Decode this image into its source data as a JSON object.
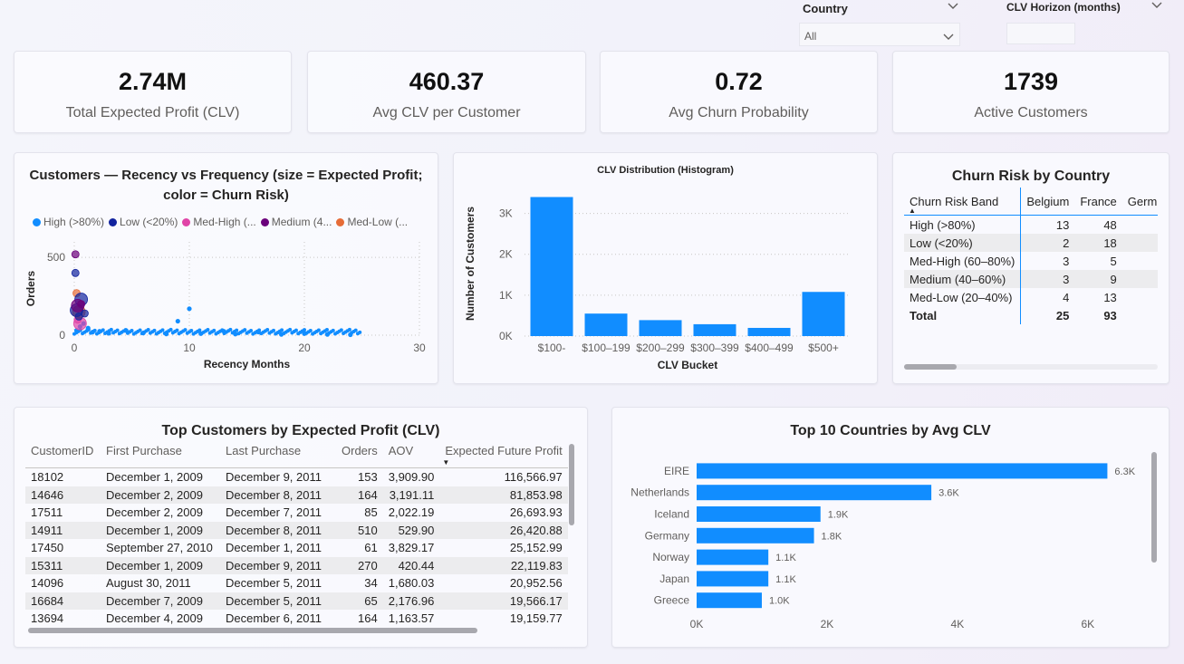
{
  "filters": {
    "country": {
      "label": "Country",
      "value": "All"
    },
    "horizon": {
      "label": "CLV Horizon (months)",
      "value": ""
    }
  },
  "kpis": [
    {
      "value": "2.74M",
      "label": "Total Expected Profit (CLV)"
    },
    {
      "value": "460.37",
      "label": "Avg CLV per Customer"
    },
    {
      "value": "0.72",
      "label": "Avg Churn Probability"
    },
    {
      "value": "1739",
      "label": "Active Customers"
    }
  ],
  "scatter": {
    "title_line1": "Customers — Recency vs Frequency (size = Expected Profit;",
    "title_line2": "color = Churn Risk)",
    "legend": [
      {
        "label": "High (>80%)",
        "color": "#118dff"
      },
      {
        "label": "Low (<20%)",
        "color": "#12239e"
      },
      {
        "label": "Med-High (...",
        "color": "#e044a7"
      },
      {
        "label": "Medium (4...",
        "color": "#6b007b"
      },
      {
        "label": "Med-Low (...",
        "color": "#e66c37"
      }
    ],
    "chart_data": {
      "type": "scatter",
      "xlabel": "Recency Months",
      "ylabel": "Orders",
      "xlim": [
        0,
        30
      ],
      "ylim": [
        0,
        600
      ],
      "x_ticks": [
        "0",
        "10",
        "20",
        "30"
      ],
      "y_ticks": [
        "0",
        "500"
      ],
      "series": [
        {
          "name": "High (>80%)",
          "points": [
            [
              0.2,
              30
            ],
            [
              0.5,
              55
            ],
            [
              0.8,
              75
            ],
            [
              1.2,
              45
            ],
            [
              1.6,
              20
            ],
            [
              2.2,
              25
            ],
            [
              3,
              12
            ],
            [
              4.5,
              30
            ],
            [
              6,
              14
            ],
            [
              8,
              8
            ],
            [
              9,
              90
            ],
            [
              10,
              170
            ],
            [
              11,
              10
            ],
            [
              13,
              25
            ],
            [
              14,
              7
            ],
            [
              16,
              20
            ],
            [
              18,
              5
            ],
            [
              20,
              10
            ],
            [
              22,
              5
            ],
            [
              24,
              3
            ]
          ]
        },
        {
          "name": "Low (<20%)",
          "points": [
            [
              0.1,
              400
            ],
            [
              0.2,
              160
            ],
            [
              0.4,
              120
            ],
            [
              0.6,
              230
            ],
            [
              0.9,
              140
            ]
          ]
        },
        {
          "name": "Med-High (60–80%)",
          "points": [
            [
              0.3,
              100
            ],
            [
              0.5,
              75
            ]
          ]
        },
        {
          "name": "Medium (40–60%)",
          "points": [
            [
              0.1,
              520
            ],
            [
              0.3,
              190
            ],
            [
              0.6,
              200
            ]
          ]
        },
        {
          "name": "Med-Low (20–40%)",
          "points": [
            [
              0.2,
              270
            ],
            [
              0.4,
              150
            ]
          ]
        }
      ]
    }
  },
  "histogram": {
    "title": "CLV Distribution (Histogram)",
    "chart_data": {
      "type": "bar",
      "categories": [
        "$100-",
        "$100–199",
        "$200–299",
        "$300–399",
        "$400–499",
        "$500+"
      ],
      "values": [
        3400,
        550,
        390,
        290,
        200,
        1080
      ],
      "xlabel": "CLV Bucket",
      "ylabel": "Number of Customers",
      "ylim": [
        0,
        3500
      ],
      "y_ticks": [
        "0K",
        "1K",
        "2K",
        "3K"
      ],
      "color": "#118dff"
    }
  },
  "churn_matrix": {
    "title": "Churn Risk by Country",
    "columns": [
      "Churn Risk Band",
      "Belgium",
      "France",
      "Germ"
    ],
    "rows": [
      [
        "High (>80%)",
        "13",
        "48"
      ],
      [
        "Low (<20%)",
        "2",
        "18"
      ],
      [
        "Med-High (60–80%)",
        "3",
        "5"
      ],
      [
        "Medium (40–60%)",
        "3",
        "9"
      ],
      [
        "Med-Low (20–40%)",
        "4",
        "13"
      ]
    ],
    "total": [
      "Total",
      "25",
      "93"
    ],
    "sort_icon": "▲"
  },
  "customers_table": {
    "title": "Top Customers by Expected Profit (CLV)",
    "columns": [
      "CustomerID",
      "First Purchase",
      "Last Purchase",
      "Orders",
      "AOV",
      "Expected Future Profit"
    ],
    "sort_icon": "▼",
    "rows": [
      [
        "18102",
        "December 1, 2009",
        "December 9, 2011",
        "153",
        "3,909.90",
        "116,566.97"
      ],
      [
        "14646",
        "December 2, 2009",
        "December 8, 2011",
        "164",
        "3,191.11",
        "81,853.98"
      ],
      [
        "17511",
        "December 2, 2009",
        "December 7, 2011",
        "85",
        "2,022.19",
        "26,693.93"
      ],
      [
        "14911",
        "December 1, 2009",
        "December 8, 2011",
        "510",
        "529.90",
        "26,420.88"
      ],
      [
        "17450",
        "September 27, 2010",
        "December 1, 2011",
        "61",
        "3,829.17",
        "25,152.99"
      ],
      [
        "15311",
        "December 1, 2009",
        "December 9, 2011",
        "270",
        "420.44",
        "22,119.83"
      ],
      [
        "14096",
        "August 30, 2011",
        "December 5, 2011",
        "34",
        "1,680.03",
        "20,952.56"
      ],
      [
        "16684",
        "December 7, 2009",
        "December 5, 2011",
        "65",
        "2,176.96",
        "19,566.17"
      ],
      [
        "13694",
        "December 4, 2009",
        "December 6, 2011",
        "164",
        "1,163.57",
        "19,159.77"
      ]
    ]
  },
  "countries": {
    "title": "Top 10 Countries by Avg CLV",
    "chart_data": {
      "type": "bar",
      "orientation": "horizontal",
      "categories": [
        "EIRE",
        "Netherlands",
        "Iceland",
        "Germany",
        "Norway",
        "Japan",
        "Greece"
      ],
      "values": [
        6300,
        3600,
        1900,
        1800,
        1100,
        1100,
        1000
      ],
      "data_labels": [
        "6.3K",
        "3.6K",
        "1.9K",
        "1.8K",
        "1.1K",
        "1.1K",
        "1.0K"
      ],
      "x_ticks": [
        "0K",
        "2K",
        "4K",
        "6K"
      ],
      "xlim": [
        0,
        6600
      ],
      "color": "#118dff"
    }
  }
}
